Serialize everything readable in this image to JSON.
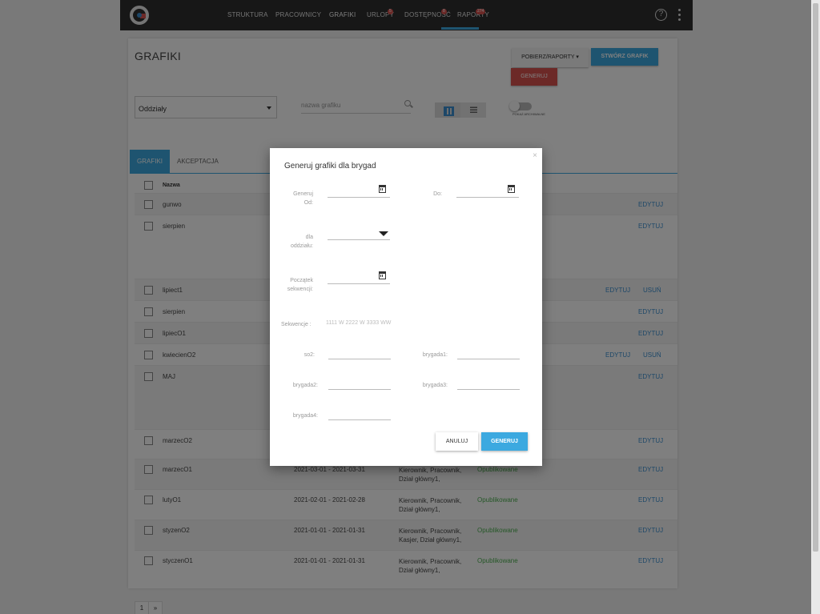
{
  "nav": {
    "items": [
      {
        "label": "STRUKTURA"
      },
      {
        "label": "PRACOWNICY"
      },
      {
        "label": "GRAFIKI"
      },
      {
        "label": "URLOPY",
        "badge": "5"
      },
      {
        "label": "DOSTĘPNOŚĆ",
        "badge": "8"
      },
      {
        "label": "RAPORTY",
        "badge": "274"
      }
    ],
    "active": "GRAFIKI",
    "help": "?"
  },
  "page": {
    "title": "GRAFIKI",
    "reports_label": "POBIERZ/RAPORTY ▾",
    "create_label": "STWÓRZ GRAFIK",
    "generate_label": "GENERUJ",
    "department_select": "Oddziały",
    "search_placeholder": "nazwa grafiku",
    "show_archived_label": "POKAŻ ARCHIWALNE",
    "accent": "#3ca9e0",
    "danger": "#d9534f",
    "status_color": "#4caf50"
  },
  "tabs": [
    {
      "label": "GRAFIKI"
    },
    {
      "label": "AKCEPTACJA"
    }
  ],
  "table": {
    "header_name": "Nazwa",
    "rows": [
      {
        "name": "gunwo",
        "dates": "",
        "roles": "",
        "status": "",
        "actions": [
          "EDYTUJ"
        ]
      },
      {
        "name": "sierpien",
        "dates": "",
        "roles": "",
        "status": "",
        "actions": [
          "EDYTUJ"
        ]
      },
      {
        "name": "lipiect1",
        "dates": "",
        "roles": "",
        "status": "",
        "actions": [
          "EDYTUJ",
          "USUŃ"
        ]
      },
      {
        "name": "sierpien",
        "dates": "",
        "roles": "",
        "status": "",
        "actions": [
          "EDYTUJ"
        ]
      },
      {
        "name": "lipiecO1",
        "dates": "",
        "roles": "",
        "status": "",
        "actions": [
          "EDYTUJ"
        ]
      },
      {
        "name": "kwiecienO2",
        "dates": "",
        "roles": "",
        "status": "",
        "actions": [
          "EDYTUJ",
          "USUŃ"
        ]
      },
      {
        "name": "MAJ",
        "dates": "",
        "roles": "",
        "status": "",
        "actions": [
          "EDYTUJ"
        ]
      },
      {
        "name": "marzecO2",
        "dates": "",
        "roles": "",
        "status": "",
        "actions": [
          "EDYTUJ"
        ]
      },
      {
        "name": "marzecO1",
        "dates": "2021-03-01 - 2021-03-31",
        "roles": "Kierownik, Pracownik, Dział główny1,",
        "status": "Opublikowane",
        "actions": [
          "EDYTUJ"
        ]
      },
      {
        "name": "lutyO1",
        "dates": "2021-02-01 - 2021-02-28",
        "roles": "Kierownik, Pracownik, Dział główny1,",
        "status": "Opublikowane",
        "actions": [
          "EDYTUJ"
        ]
      },
      {
        "name": "styzenO2",
        "dates": "2021-01-01 - 2021-01-31",
        "roles": "Kierownik, Pracownik, Kasjer, Dział główny1,",
        "status": "Opublikowane",
        "actions": [
          "EDYTUJ"
        ]
      },
      {
        "name": "styczenO1",
        "dates": "2021-01-01 - 2021-01-31",
        "roles": "Kierownik, Pracownik, Dział główny1,",
        "status": "Opublikowane",
        "actions": [
          "EDYTUJ"
        ]
      }
    ]
  },
  "pager": {
    "current": "1",
    "next": "»"
  },
  "modal": {
    "close": "×",
    "title": "Generuj grafiki dla brygad",
    "generate_from_label": "Generuj Od:",
    "to_label": "Do:",
    "department_label": "dla oddziału:",
    "sequence_start_label": "Początek sekwencji:",
    "sequences_label": "Sekwencje :",
    "sequences_value": "1111 W 2222 W 3333 WW",
    "so2_label": "so2:",
    "brigade1_label": "brygada1:",
    "brigade2_label": "brygada2:",
    "brigade3_label": "brygada3:",
    "brigade4_label": "brygada4:",
    "cancel_label": "ANULUJ",
    "submit_label": "GENERUJ"
  }
}
